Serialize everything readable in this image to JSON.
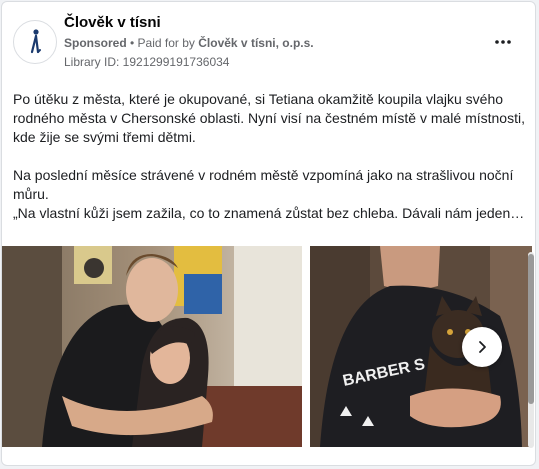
{
  "ad": {
    "page_name": "Člověk v tísni",
    "sponsored_label": "Sponsored",
    "separator": " • ",
    "paid_for_prefix": "Paid for by ",
    "paid_for_by": "Člověk v tísni, o.p.s.",
    "library_id": "Library ID: 1921299191736034",
    "more_icon": "more-horizontal-icon",
    "logo_icon": "organization-logo-icon"
  },
  "post": {
    "paragraph_1": "Po útěku z města, které je okupované, si Tetiana okamžitě koupila vlajku svého rodného města v Chersonské oblasti. Nyní visí na čestném místě v malé místnosti, kde žije se svými třemi dětmi.",
    "paragraph_2_line_1": "Na poslední měsíce strávené v rodném městě vzpomíná jako na strašlivou noční můru.",
    "paragraph_2_line_2": "„Na vlastní kůži jsem zažila, co to znamená zůstat bez chleba. Dávali nám jeden…"
  },
  "media": {
    "photo_1_text": "",
    "photo_2_shirt_text": "BARBER S",
    "next_icon": "chevron-right-icon"
  },
  "colors": {
    "text": "#1c1e21",
    "secondary": "#65676b",
    "logo": "#1a3a6e"
  }
}
